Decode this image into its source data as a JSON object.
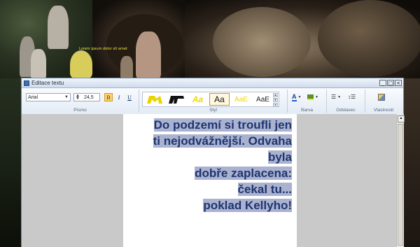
{
  "background": {
    "lorem_text": "Lorem ipsum dolor sit amet"
  },
  "window": {
    "title": "Editace textu",
    "controls": {
      "minimize": "_",
      "maximize": "□",
      "close": "×"
    }
  },
  "ribbon": {
    "font_group": {
      "label": "Písmo",
      "font_name": "Arial",
      "font_size": "24,5",
      "bold": "B",
      "italic": "I",
      "underline": "U",
      "bold_active": true
    },
    "style_group": {
      "label": "Styl",
      "tiles": [
        {
          "text": "",
          "color": "#e8d400"
        },
        {
          "text": "",
          "color": "#111111"
        },
        {
          "text": "Aa",
          "color": "#f0d800"
        },
        {
          "text": "Aa",
          "color": "#111111",
          "selected": true
        },
        {
          "text": "AaE",
          "color": "#f0d800"
        },
        {
          "text": "AaE",
          "color": "#222222"
        }
      ]
    },
    "color_group": {
      "label": "Barva",
      "font_color_icon": "font-color-icon",
      "highlight_icon": "highlight-icon"
    },
    "paragraph_group": {
      "label": "Odstavec",
      "align_icon": "align-icon",
      "spacing_icon": "line-spacing-icon"
    },
    "properties_group": {
      "label": "Vlastnosti",
      "icon": "properties-icon"
    }
  },
  "document": {
    "lines": [
      "Do podzemí si troufli jen",
      "ti nejodvážnější. Odvaha",
      "byla",
      "dobře zaplacena:",
      "čekal tu...",
      "poklad Kellyho!"
    ],
    "text_color": "#1e3572",
    "highlight_color": "#aab2cf"
  }
}
